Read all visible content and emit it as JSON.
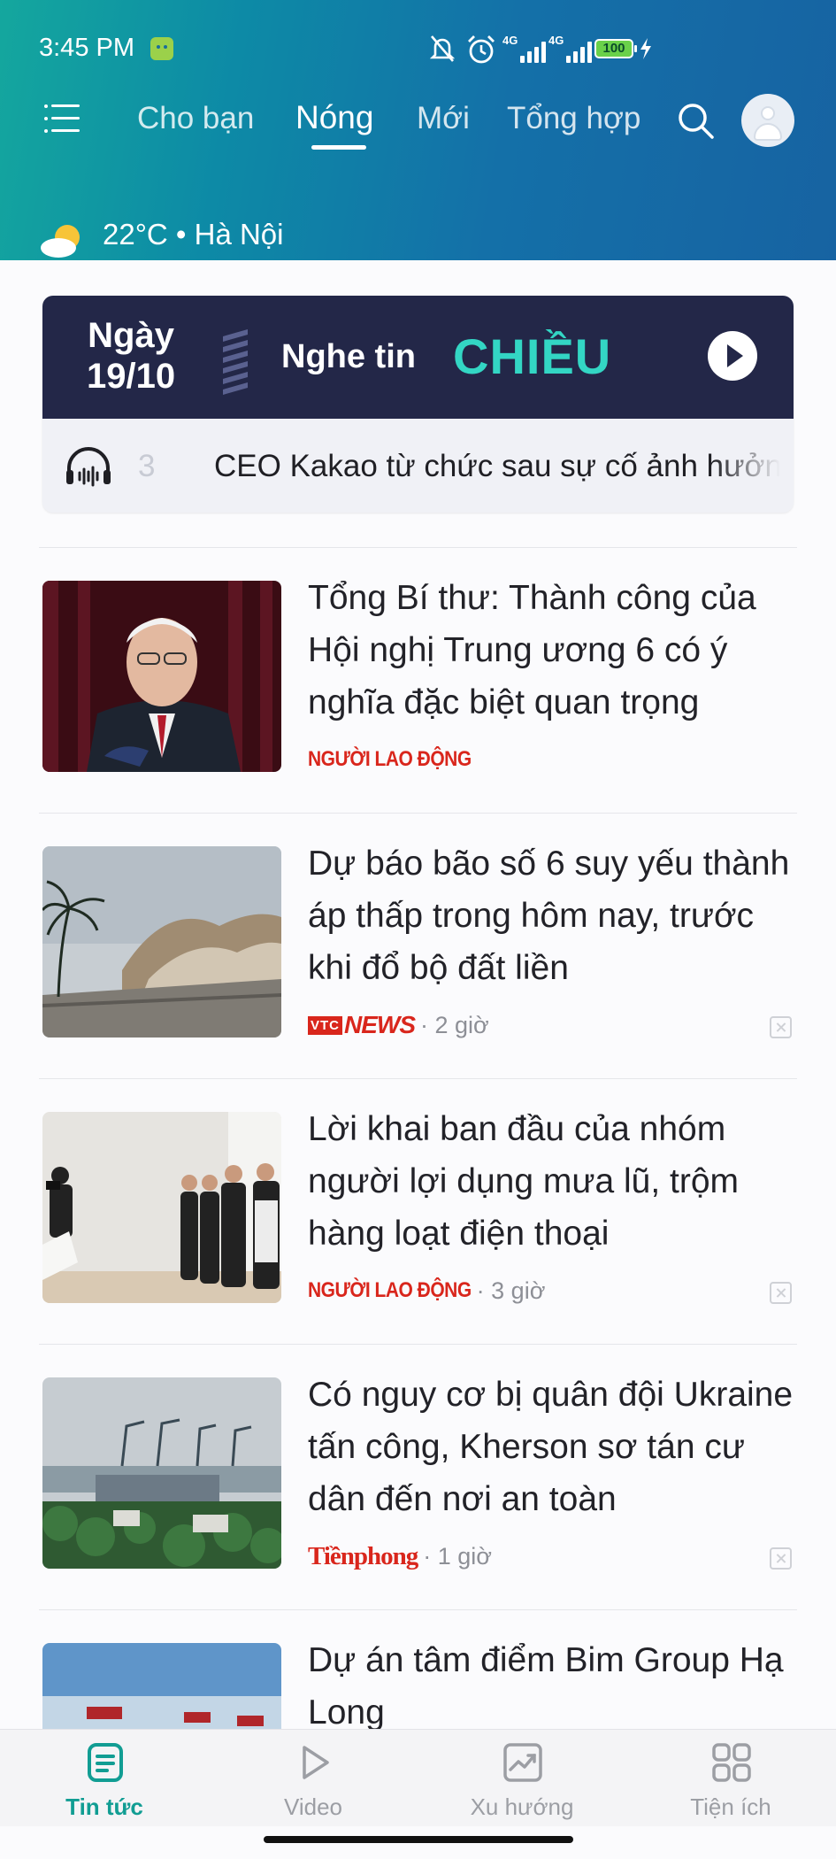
{
  "status_bar": {
    "time": "3:45 PM",
    "signal_1_label": "4G",
    "signal_2_label": "4G",
    "battery": "100"
  },
  "header": {
    "tabs": [
      {
        "label": "Cho bạn",
        "active": false
      },
      {
        "label": "Nóng",
        "active": true
      },
      {
        "label": "Mới",
        "active": false
      },
      {
        "label": "Tổng hợp",
        "active": false
      }
    ],
    "weather": "22°C • Hà Nội",
    "gradient_colors": [
      "#14a79e",
      "#1470a8"
    ]
  },
  "audio_banner": {
    "date_line1": "Ngày",
    "date_line2": "19/10",
    "title": "Nghe tin",
    "title_accent": "CHIỀU",
    "index": "3",
    "ticker": "CEO Kakao từ chức sau sự cố ảnh hưởng",
    "accent_color": "#33d6c4",
    "background_color": "#232748"
  },
  "articles": [
    {
      "title": "Tổng Bí thư: Thành công của Hội nghị Trung ương 6 có ý nghĩa đặc biệt quan trọng",
      "source": "NGƯỜI LAO ĐỘNG",
      "time": ""
    },
    {
      "title": "Dự báo bão số 6 suy yếu thành áp thấp trong hôm nay, trước khi đổ bộ đất liền",
      "source_a": "VTC",
      "source_b": "NEWS",
      "time": "· 2 giờ"
    },
    {
      "title": "Lời khai ban đầu của nhóm người lợi dụng mưa lũ, trộm hàng loạt điện thoại",
      "source": "NGƯỜI LAO ĐỘNG",
      "time": "· 3 giờ"
    },
    {
      "title": "Có nguy cơ bị quân đội Ukraine tấn công, Kherson sơ tán cư dân đến nơi an toàn",
      "source": "Tiềnphong",
      "time": "· 1 giờ"
    },
    {
      "title": "Dự án tâm điểm Bim Group Hạ Long",
      "source": "",
      "time": ""
    }
  ],
  "bottom_nav": [
    {
      "label": "Tin tức",
      "icon": "news-icon",
      "active": true
    },
    {
      "label": "Video",
      "icon": "play-icon",
      "active": false
    },
    {
      "label": "Xu hướng",
      "icon": "trending-icon",
      "active": false
    },
    {
      "label": "Tiện ích",
      "icon": "apps-grid-icon",
      "active": false
    }
  ],
  "colors": {
    "brand_teal": "#119d93",
    "source_red": "#d9261c"
  }
}
